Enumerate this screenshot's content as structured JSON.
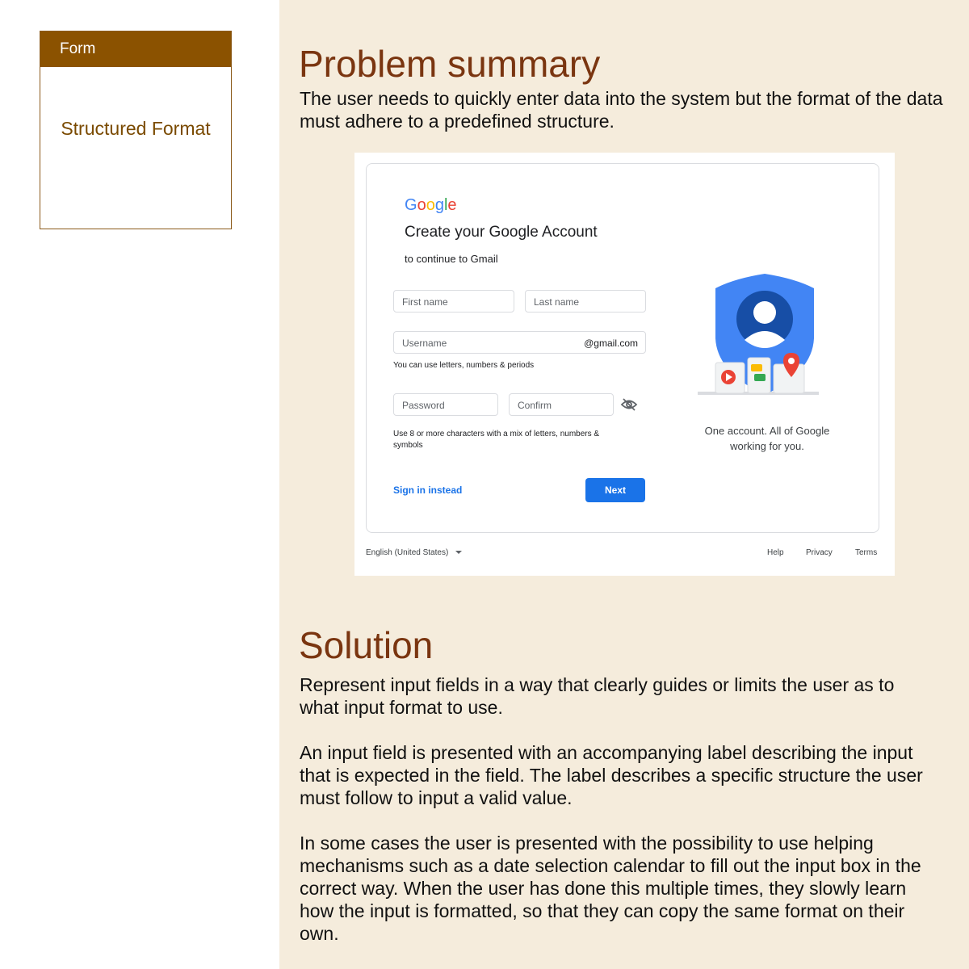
{
  "sidebar": {
    "card_header": "Form",
    "card_body": "Structured Format"
  },
  "problem": {
    "heading": "Problem summary",
    "text_line1": "The user needs to quickly enter data into the system but the format of the data",
    "text_line2": "must adhere to a predefined structure."
  },
  "screenshot": {
    "logo": [
      "G",
      "o",
      "o",
      "g",
      "l",
      "e"
    ],
    "logo_colors": [
      "#4285F4",
      "#EA4335",
      "#FBBC05",
      "#4285F4",
      "#34A853",
      "#EA4335"
    ],
    "title": "Create your Google Account",
    "subtitle": "to continue to Gmail",
    "first_name_placeholder": "First name",
    "last_name_placeholder": "Last name",
    "username_placeholder": "Username",
    "username_suffix": "@gmail.com",
    "username_hint": "You can use letters, numbers & periods",
    "password_placeholder": "Password",
    "confirm_placeholder": "Confirm",
    "password_hint_line1": "Use 8 or more characters with a mix of letters, numbers &",
    "password_hint_line2": "symbols",
    "sign_in_label": "Sign in instead",
    "next_label": "Next",
    "illustration_line1": "One account. All of Google",
    "illustration_line2": "working for you.",
    "language": "English (United States)",
    "footer_links": [
      "Help",
      "Privacy",
      "Terms"
    ],
    "accent_color": "#1a73e8"
  },
  "solution": {
    "heading": "Solution",
    "p1_line1": "Represent input fields in a way that clearly guides or limits the user as to",
    "p1_line2": "what input format to use.",
    "p2_line1": "An input field is presented with an accompanying label describing the input",
    "p2_line2": "that is expected in the field. The label describes a specific structure the user",
    "p2_line3": "must follow to input a valid value.",
    "p3_line1": "In some cases the user is presented with the possibility to use helping",
    "p3_line2": "mechanisms such as a date selection calendar to fill out the input box in the",
    "p3_line3": "correct way. When the user has done this multiple times, they slowly learn",
    "p3_line4": "how the input is formatted, so that they can copy the same format on their",
    "p3_line5": "own."
  }
}
